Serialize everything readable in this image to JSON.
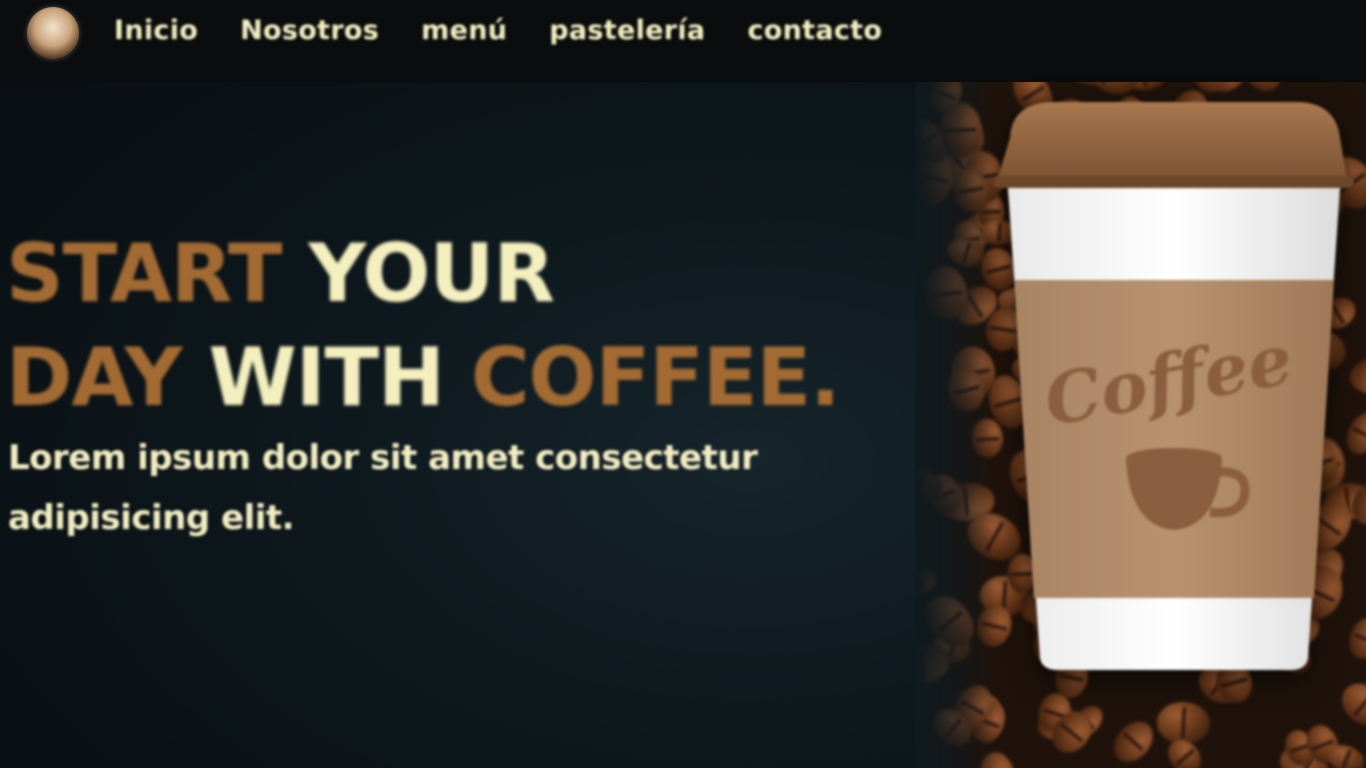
{
  "nav": {
    "logo": "coffee-logo-icon",
    "links": [
      "Inicio",
      "Nosotros",
      "menú",
      "pastelería",
      "contacto"
    ]
  },
  "hero": {
    "title_words": [
      "START",
      "YOUR",
      "DAY",
      "WITH",
      "COFFEE."
    ],
    "subtitle": "Lorem ipsum dolor sit amet consectetur adipisicing elit."
  },
  "cup": {
    "label": "Coffee",
    "icon": "coffee-cup-icon"
  },
  "colors": {
    "accent_brown": "#a36b33",
    "cream": "#f4efbe",
    "background": "#0c1418",
    "navbar": "#0a0c0d"
  }
}
